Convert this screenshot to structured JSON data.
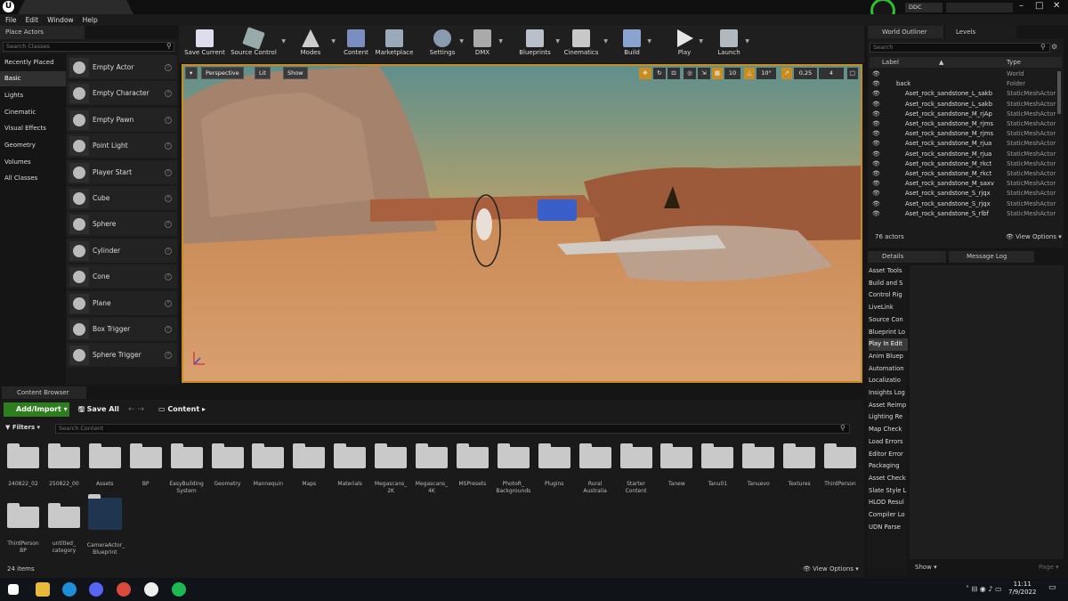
{
  "menu": [
    "File",
    "Edit",
    "Window",
    "Help"
  ],
  "titlebar": {
    "ddc": "DDC"
  },
  "place_actors": {
    "tab": "Place Actors",
    "search_placeholder": "Search Classes",
    "categories": [
      "Recently Placed",
      "Basic",
      "Lights",
      "Cinematic",
      "Visual Effects",
      "Geometry",
      "Volumes",
      "All Classes"
    ],
    "selected_category": "Basic",
    "items": [
      "Empty Actor",
      "Empty Character",
      "Empty Pawn",
      "Point Light",
      "Player Start",
      "Cube",
      "Sphere",
      "Cylinder",
      "Cone",
      "Plane",
      "Box Trigger",
      "Sphere Trigger"
    ],
    "help": "?"
  },
  "toolbar": [
    "Save Current",
    "Source Control",
    "Modes",
    "Content",
    "Marketplace",
    "Settings",
    "DMX",
    "Blueprints",
    "Cinematics",
    "Build",
    "Play",
    "Launch"
  ],
  "viewport": {
    "perspective": "Perspective",
    "lit": "Lit",
    "show": "Show",
    "grid": "10",
    "rotation": "10°",
    "scale": "0,25",
    "cams": "4"
  },
  "outliner": {
    "tab": "World Outliner",
    "levels_tab": "Levels",
    "search_placeholder": "Search",
    "col_label": "Label",
    "col_type": "Type",
    "rows": [
      {
        "label": "",
        "type": "World"
      },
      {
        "label": "back",
        "type": "Folder"
      },
      {
        "label": "Aset_rock_sandstone_L_sakb",
        "type": "StaticMeshActor"
      },
      {
        "label": "Aset_rock_sandstone_L_sakb",
        "type": "StaticMeshActor"
      },
      {
        "label": "Aset_rock_sandstone_M_rjAp",
        "type": "StaticMeshActor"
      },
      {
        "label": "Aset_rock_sandstone_M_rjms",
        "type": "StaticMeshActor"
      },
      {
        "label": "Aset_rock_sandstone_M_rjms",
        "type": "StaticMeshActor"
      },
      {
        "label": "Aset_rock_sandstone_M_rjua",
        "type": "StaticMeshActor"
      },
      {
        "label": "Aset_rock_sandstone_M_rjua",
        "type": "StaticMeshActor"
      },
      {
        "label": "Aset_rock_sandstone_M_rkct",
        "type": "StaticMeshActor"
      },
      {
        "label": "Aset_rock_sandstone_M_rkct",
        "type": "StaticMeshActor"
      },
      {
        "label": "Aset_rock_sandstone_M_saxv",
        "type": "StaticMeshActor"
      },
      {
        "label": "Aset_rock_sandstone_S_rjqx",
        "type": "StaticMeshActor"
      },
      {
        "label": "Aset_rock_sandstone_S_rjqx",
        "type": "StaticMeshActor"
      },
      {
        "label": "Aset_rock_sandstone_S_rlbf",
        "type": "StaticMeshActor"
      }
    ],
    "count": "76 actors",
    "view_options": "View Options"
  },
  "details": {
    "tab": "Details",
    "msglog_tab": "Message Log",
    "show": "Show",
    "page": "Page"
  },
  "log_categories": [
    "Asset Tools",
    "Build and S",
    "Control Rig",
    "LiveLink",
    "Source Con",
    "Blueprint Lo",
    "Play In Edit",
    "Anim Bluep",
    "Automation",
    "Localizatio",
    "Insights Log",
    "Asset Reimp",
    "Lighting Re",
    "Map Check",
    "Load Errors",
    "Editor Error",
    "Packaging",
    "Asset Check",
    "Slate Style L",
    "HLOD Resul",
    "Compiler Lo",
    "UDN Parse"
  ],
  "selected_log": "Play In Edit",
  "content_browser": {
    "tab": "Content Browser",
    "add_import": "Add/Import",
    "save_all": "Save All",
    "crumb": "Content",
    "filters": "Filters",
    "search_placeholder": "Search Content",
    "folders": [
      "240822_02",
      "250822_00",
      "Assets",
      "BP",
      "EasyBuilding System",
      "Geometry",
      "Mannequin",
      "Maps",
      "Materials",
      "Megascans_ 2K",
      "Megascans_ 4K",
      "MSPresets",
      "PhotoR_ Backgrounds",
      "Plugins",
      "Rural Australia",
      "Starter Content",
      "Tanew",
      "Tanu01",
      "Tanuevo",
      "Textures",
      "ThirdPerson",
      "ThirdPerson BP",
      "untitled_ category",
      "CameraActor_ Blueprint"
    ],
    "count": "24 items",
    "view_options": "View Options"
  },
  "taskbar": {
    "time": "11:11",
    "date": "7/9/2022"
  },
  "colors": {
    "accent": "#c88d1e",
    "add_button": "#2e7d1f",
    "selection": "#303030"
  }
}
